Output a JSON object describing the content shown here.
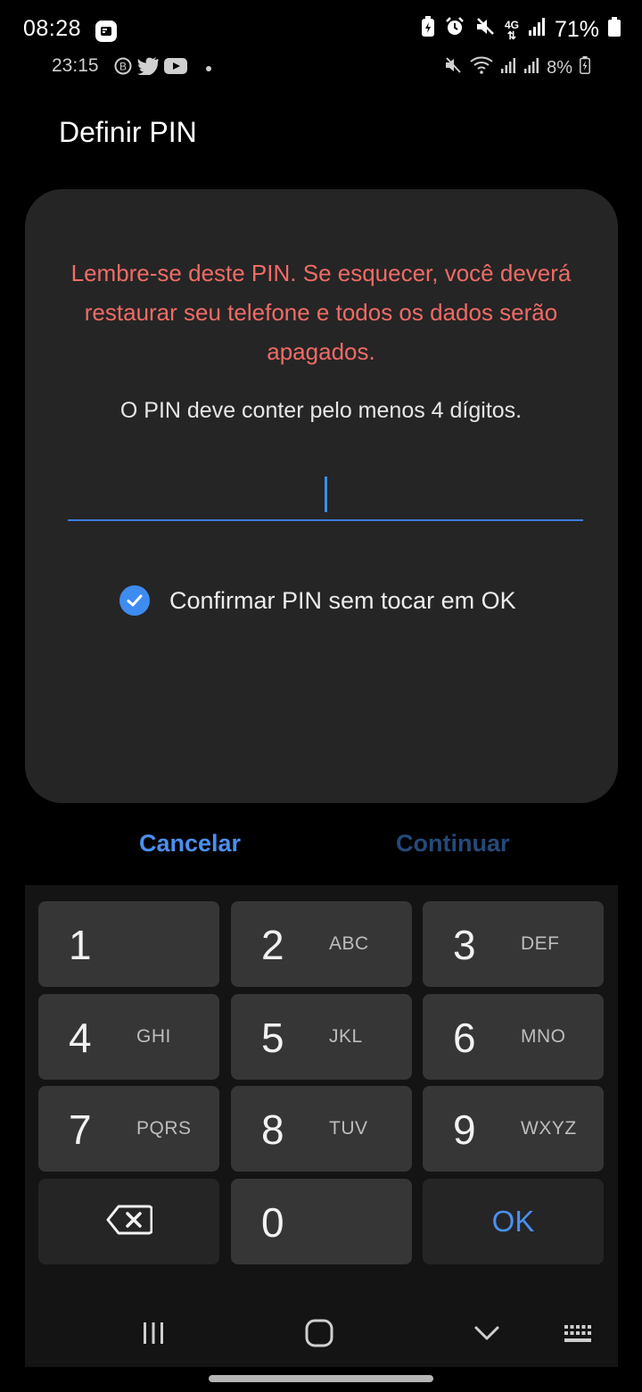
{
  "status": {
    "time": "08:28",
    "battery": "71%",
    "network": "4G",
    "secondary_time": "23:15",
    "secondary_battery": "8%"
  },
  "page": {
    "title": "Definir PIN"
  },
  "dialog": {
    "warning": "Lembre-se deste PIN. Se esquecer, você deverá restaurar seu telefone e todos os dados serão apagados.",
    "hint": "O PIN deve conter pelo menos 4 dígitos.",
    "pin_value": "",
    "confirm_label": "Confirmar PIN sem tocar em OK",
    "confirm_checked": true
  },
  "actions": {
    "cancel": "Cancelar",
    "continue": "Continuar"
  },
  "keypad": {
    "k1": {
      "num": "1",
      "letters": ""
    },
    "k2": {
      "num": "2",
      "letters": "ABC"
    },
    "k3": {
      "num": "3",
      "letters": "DEF"
    },
    "k4": {
      "num": "4",
      "letters": "GHI"
    },
    "k5": {
      "num": "5",
      "letters": "JKL"
    },
    "k6": {
      "num": "6",
      "letters": "MNO"
    },
    "k7": {
      "num": "7",
      "letters": "PQRS"
    },
    "k8": {
      "num": "8",
      "letters": "TUV"
    },
    "k9": {
      "num": "9",
      "letters": "WXYZ"
    },
    "k0": {
      "num": "0"
    },
    "ok": "OK"
  },
  "colors": {
    "accent": "#4a90f0",
    "warning": "#f06b66"
  }
}
